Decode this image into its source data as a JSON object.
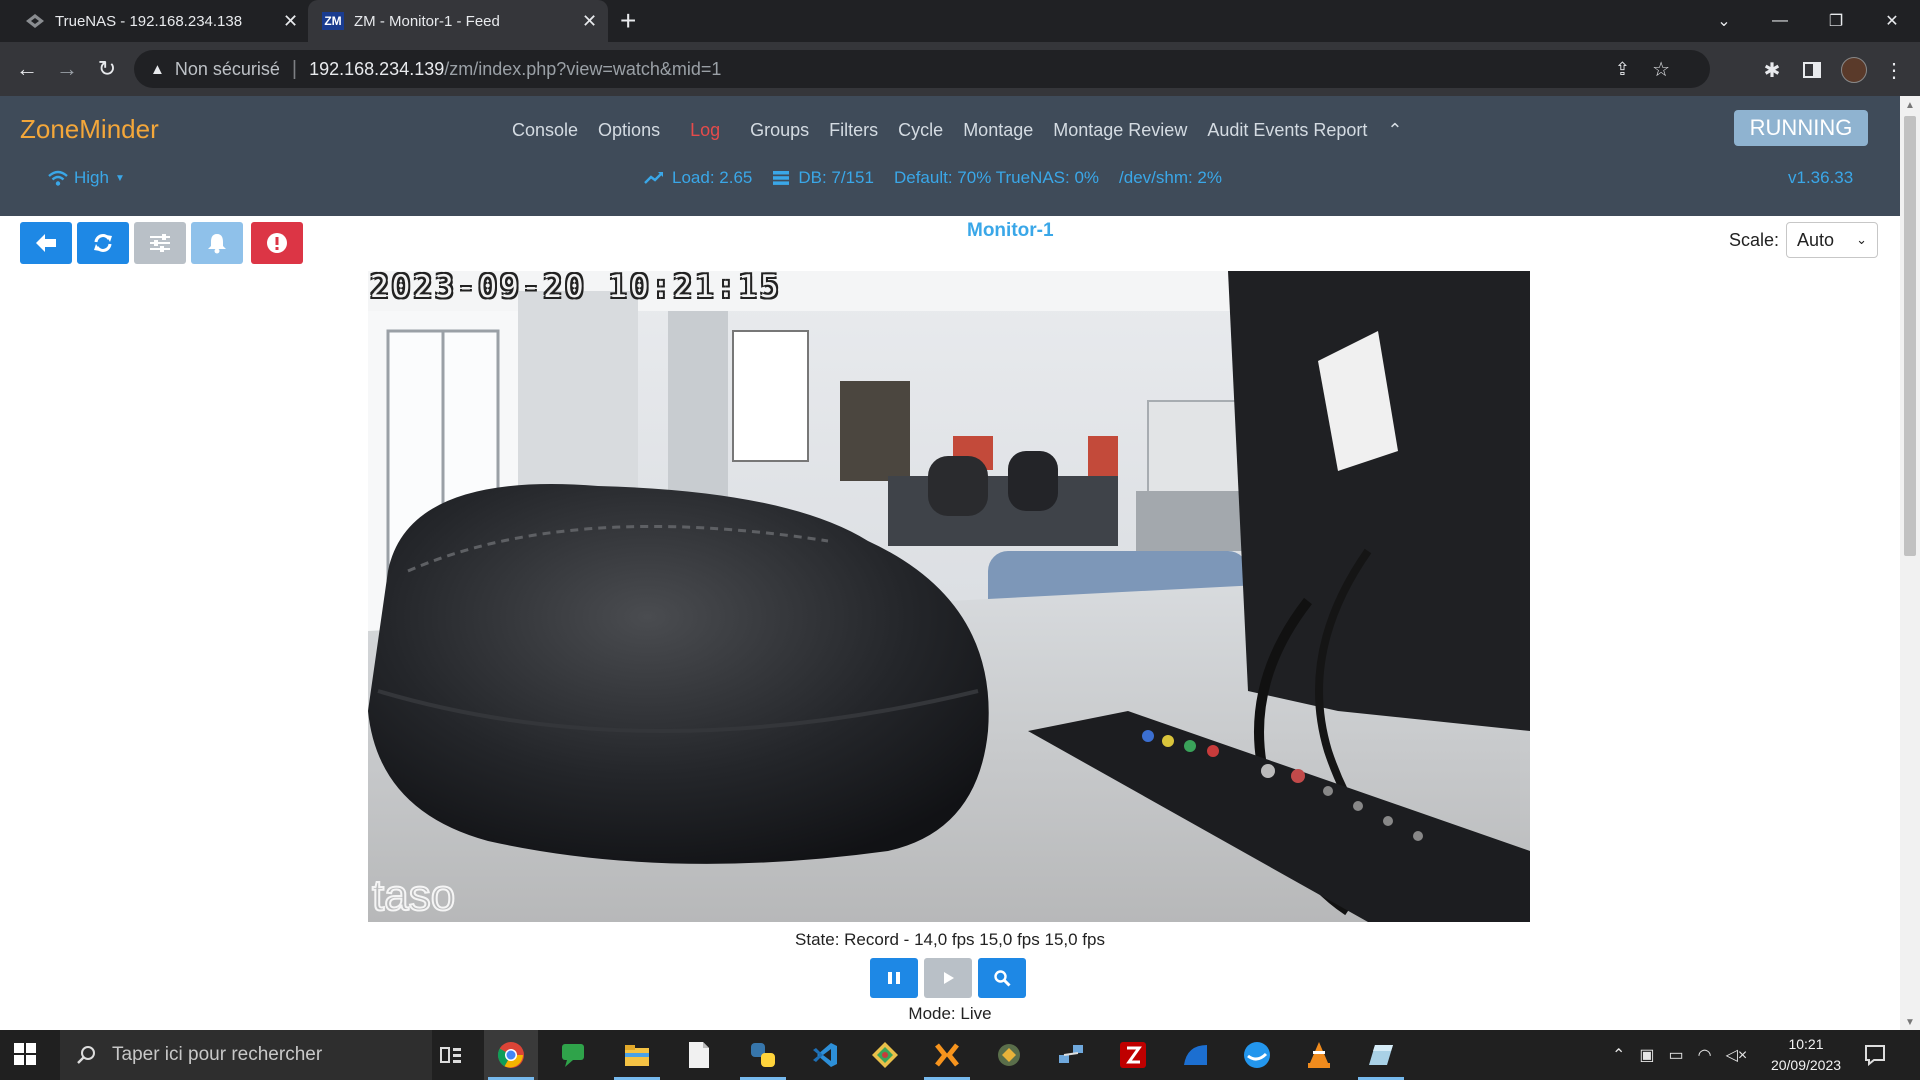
{
  "browser": {
    "tabs": [
      {
        "title": "TrueNAS - 192.168.234.138",
        "active": false
      },
      {
        "title": "ZM - Monitor-1 - Feed",
        "active": true
      }
    ],
    "security_label": "Non sécurisé",
    "url_host": "192.168.234.139",
    "url_path": "/zm/index.php?view=watch&mid=1"
  },
  "zm": {
    "logo": "ZoneMinder",
    "nav": [
      "Console",
      "Options",
      "Log",
      "Groups",
      "Filters",
      "Cycle",
      "Montage",
      "Montage Review",
      "Audit Events Report"
    ],
    "active_nav": "Log",
    "run_state": "RUNNING",
    "bandwidth": "High",
    "load": "Load: 2.65",
    "db": "DB: 7/151",
    "storage": "Default: 70% TrueNAS: 0%",
    "shm": "/dev/shm: 2%",
    "version": "v1.36.33"
  },
  "monitor": {
    "title": "Monitor-1",
    "scale_label": "Scale:",
    "scale_value": "Auto",
    "timestamp": "2023-09-20 10:21:15",
    "watermark": "taso",
    "state": "State: Record - 14,0 fps 15,0 fps 15,0 fps",
    "mode": "Mode: Live"
  },
  "colors": {
    "zm_header": "#3f4b59",
    "zm_logo": "#f4a73a",
    "link_blue": "#3aa7e8",
    "btn_blue": "#1e88e5",
    "btn_danger": "#dc3545",
    "btn_grey": "#b9c0c7",
    "btn_light_blue": "#8fc1ea"
  },
  "taskbar": {
    "search_placeholder": "Taper ici pour rechercher",
    "time": "10:21",
    "date": "20/09/2023",
    "apps": [
      "chrome",
      "messaging",
      "file-explorer",
      "notepad",
      "python",
      "vscode",
      "git",
      "xampp",
      "virtualbox",
      "network",
      "filezilla",
      "edge",
      "docker",
      "vlc",
      "notes"
    ]
  }
}
